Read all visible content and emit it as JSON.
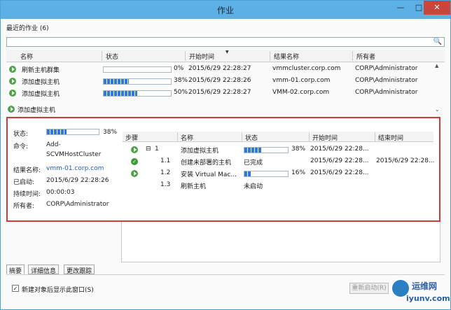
{
  "window": {
    "title": "作业",
    "min": "—",
    "max": "□",
    "close": "✕"
  },
  "recent_label": "最近的作业 (6)",
  "grid": {
    "headers": [
      "名称",
      "状态",
      "开始时间",
      "结果名称",
      "所有者"
    ],
    "rows": [
      {
        "name": "刷新主机群集",
        "progress": 0,
        "pct": "0%",
        "start": "2015/6/29 22:28:27",
        "result": "vmmcluster.corp.com",
        "owner": "CORP\\Administrator"
      },
      {
        "name": "添加虚拟主机",
        "progress": 38,
        "pct": "38%",
        "start": "2015/6/29 22:28:26",
        "result": "vmm-01.corp.com",
        "owner": "CORP\\Administrator"
      },
      {
        "name": "添加虚拟主机",
        "progress": 50,
        "pct": "50%",
        "start": "2015/6/29 22:28:27",
        "result": "VMM-02.corp.com",
        "owner": "CORP\\Administrator"
      }
    ]
  },
  "selected_job": "添加虚拟主机",
  "detail": {
    "status_label": "状态:",
    "status_progress": 38,
    "status_pct": "38%",
    "command_label": "命令:",
    "command_line1": "Add-",
    "command_line2": "SCVMHostCluster",
    "result_label": "结果名称:",
    "result_value": "vmm-01.corp.com",
    "started_label": "已启动:",
    "started_value": "2015/6/29 22:28:26",
    "duration_label": "持续时间:",
    "duration_value": "00:00:03",
    "owner_label": "所有者:",
    "owner_value": "CORP\\Administrator",
    "steps_headers": [
      "步骤",
      "名称",
      "状态",
      "开始时间",
      "结束时间"
    ],
    "steps": [
      {
        "icon": "play",
        "expander": "⊟",
        "step": "1",
        "name": "添加虚拟主机",
        "progress": 38,
        "pct": "38%",
        "start": "2015/6/29 22:28...",
        "end": ""
      },
      {
        "icon": "check",
        "expander": "",
        "step": "1.1",
        "name": "创建未部署的主机",
        "status": "已完成",
        "start": "2015/6/29 22:28...",
        "end": "2015/6/29 22:28..."
      },
      {
        "icon": "play",
        "expander": "",
        "step": "1.2",
        "name": "安装 Virtual Mac...",
        "progress": 16,
        "pct": "16%",
        "start": "2015/6/29 22:28...",
        "end": ""
      },
      {
        "icon": "",
        "expander": "",
        "step": "1.3",
        "name": "刷新主机",
        "status": "未启动",
        "start": "",
        "end": ""
      }
    ]
  },
  "tabs": [
    "摘要",
    "详细信息",
    "更改跟踪"
  ],
  "checkbox_label": "新建对象后显示此窗口(S)",
  "checkbox_mark": "✓",
  "restart_label": "重新启动(R)",
  "watermark": {
    "cn": "运维网",
    "en": "iyunv.com"
  },
  "icons": {
    "search": "🔍",
    "sort": "▼",
    "chevron": "⌄",
    "scroll_up": "▲"
  }
}
